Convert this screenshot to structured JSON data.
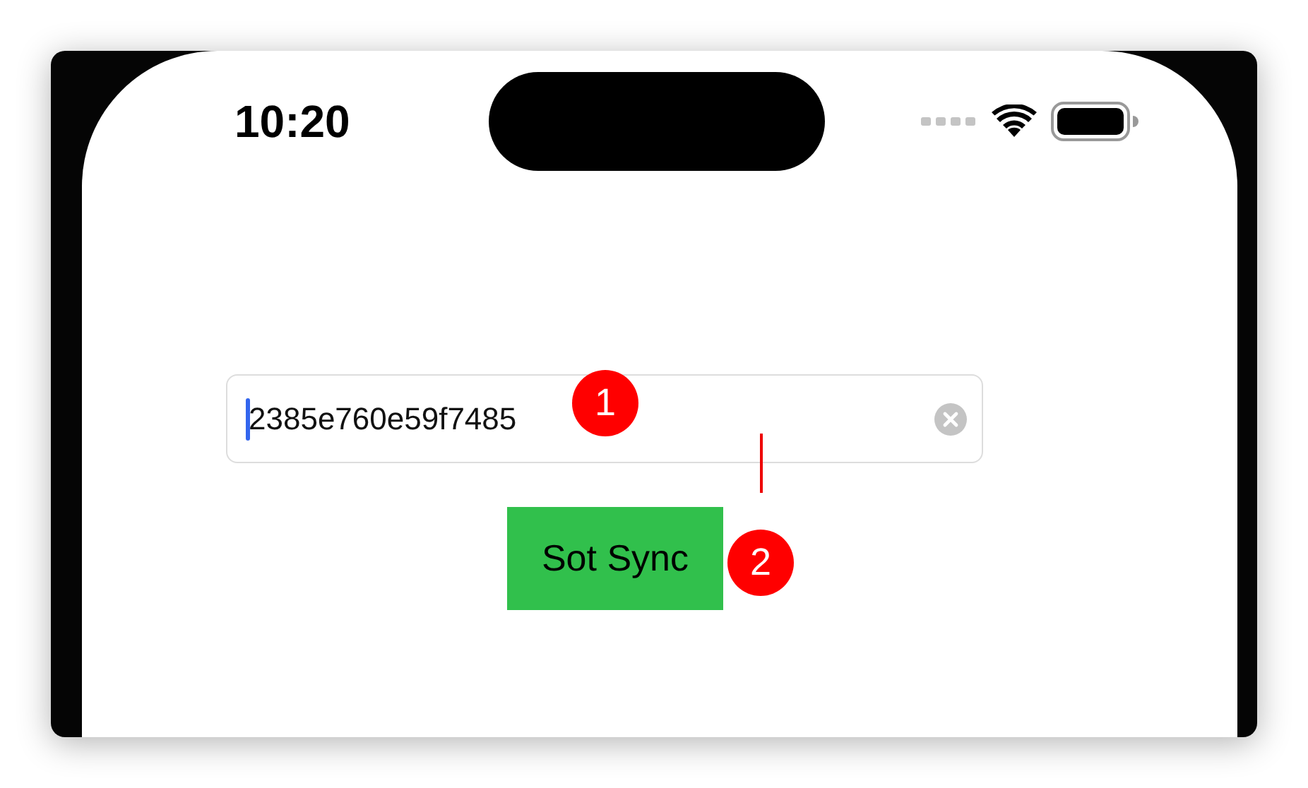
{
  "status_bar": {
    "time": "10:20"
  },
  "id_field": {
    "value": "2385e760e59f7485",
    "focused": true
  },
  "sync_button": {
    "label": "Sot Sync"
  },
  "annotations": [
    {
      "label": "1"
    },
    {
      "label": "2"
    }
  ]
}
